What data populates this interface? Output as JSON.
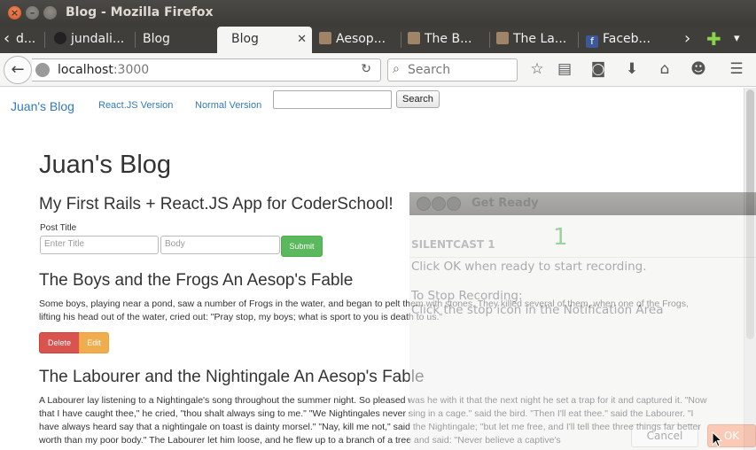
{
  "window": {
    "title": "Blog - Mozilla Firefox"
  },
  "tabs": [
    {
      "label": "d...",
      "icon": "page-icon"
    },
    {
      "label": "jundali...",
      "icon": "github-icon"
    },
    {
      "label": "Blog",
      "icon": ""
    },
    {
      "label": "Blog",
      "icon": "",
      "active": true
    },
    {
      "label": "Aesop...",
      "icon": "aesop-icon"
    },
    {
      "label": "The B...",
      "icon": "aesop-icon"
    },
    {
      "label": "The La...",
      "icon": "aesop-icon"
    },
    {
      "label": "Faceb...",
      "icon": "facebook-icon"
    }
  ],
  "navbar": {
    "url_host": "localhost",
    "url_port": ":3000",
    "search_placeholder": "Search"
  },
  "page": {
    "brand": "Juan's Blog",
    "nav_links": [
      "React.JS Version",
      "Normal Version"
    ],
    "search_button": "Search",
    "title": "Juan's Blog",
    "app_heading": "My First Rails + React.JS App for CoderSchool!",
    "form": {
      "label": "Post Title",
      "title_placeholder": "Enter Title",
      "body_placeholder": "Body",
      "submit_label": "Submit"
    },
    "posts": [
      {
        "title": "The Boys and the Frogs An Aesop's Fable",
        "body": "Some boys, playing near a pond, saw a number of Frogs in the water, and began to pelt them with stones. They killed several of them, when one of the Frogs, lifting his head out of the water, cried out: \"Pray stop, my boys; what is sport to you is death to us.\"",
        "delete_label": "Delete",
        "edit_label": "Edit"
      },
      {
        "title": "The Labourer and the Nightingale An Aesop's Fable",
        "body": "A Labourer lay listening to a Nightingale's song throughout the summer night. So pleased was he with it that the next night he set a trap for it and captured it. \"Now that I have caught thee,\" he cried, \"thou shalt always sing to me.\" \"We Nightingales never sing in a cage.\" said the bird. \"Then I'll eat thee.\" said the Labourer. \"I have always heard say that a nightingale on toast is dainty morsel.\" \"Nay, kill me not,\" said the Nightingale; \"but let me free, and I'll tell thee three things far better worth than my poor body.\" The Labourer let him loose, and he flew up to a branch of a tree and said: \"Never believe a captive's"
      }
    ]
  },
  "dialog": {
    "title": "Get Ready",
    "app_name": "SILENTCAST 1",
    "countdown": "1",
    "line1": "Click OK when ready to start recording.",
    "line2": "To Stop Recording:",
    "line3": "Click the stop icon in the Notification Area",
    "cancel_label": "Cancel",
    "ok_label": "OK"
  },
  "colors": {
    "link": "#337ab7",
    "submit": "#5cb85c",
    "delete": "#d9534f",
    "edit": "#f0ad4e",
    "countdown": "#4caf50"
  }
}
